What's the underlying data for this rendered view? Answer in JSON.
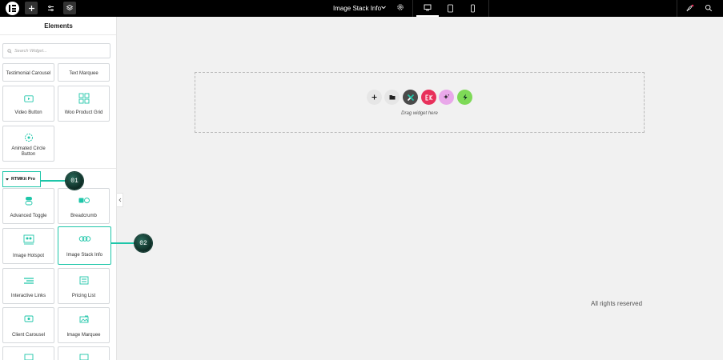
{
  "topbar": {
    "page_title": "Image Stack Info",
    "icons": [
      "elementor-logo-icon",
      "plus-icon",
      "sliders-icon",
      "layers-icon",
      "chevron-down-icon",
      "gear-icon",
      "desktop-icon",
      "tablet-icon",
      "mobile-icon",
      "rocket-icon",
      "search-icon"
    ]
  },
  "sidebar": {
    "title": "Elements",
    "search_placeholder": "Search Widget...",
    "widgets_top": [
      {
        "label": "Testimonial Carousel"
      },
      {
        "label": "Text Marquee"
      },
      {
        "label": "Video Button"
      },
      {
        "label": "Woo Product Grid"
      },
      {
        "label_line1": "Animated Circle",
        "label_line2": "Button"
      }
    ],
    "section": {
      "label": "RTMKit Pro"
    },
    "widgets_section": [
      {
        "label": "Advanced Toggle"
      },
      {
        "label": "Breadcrumb"
      },
      {
        "label": "Image Hotspot"
      },
      {
        "label": "Image Stack Info"
      },
      {
        "label": "Interactive Links"
      },
      {
        "label": "Pricing List"
      },
      {
        "label": "Client Carousel"
      },
      {
        "label": "Image Marquee"
      }
    ]
  },
  "callouts": {
    "first": "01",
    "second": "02"
  },
  "canvas": {
    "drop_text": "Drag widget here",
    "footer": "All rights reserved",
    "colors": {
      "accent": "#1ec6a9",
      "btn_add": "#e6e6e6",
      "btn_folder": "#e6e6e6",
      "btn_dark": "#4a4a4a",
      "btn_red": "#e8305b",
      "btn_pink": "#e9a8ea",
      "btn_green": "#7ed957"
    }
  }
}
